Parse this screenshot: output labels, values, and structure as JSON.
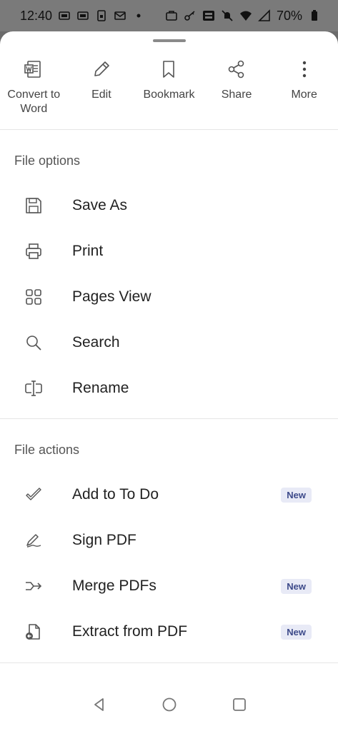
{
  "status_bar": {
    "time": "12:40",
    "battery": "70%"
  },
  "actions": [
    {
      "label": "Convert to Word",
      "icon": "word-icon"
    },
    {
      "label": "Edit",
      "icon": "pencil-icon"
    },
    {
      "label": "Bookmark",
      "icon": "bookmark-icon"
    },
    {
      "label": "Share",
      "icon": "share-icon"
    },
    {
      "label": "More",
      "icon": "more-vertical-icon"
    }
  ],
  "file_options": {
    "title": "File options",
    "items": [
      {
        "label": "Save As",
        "icon": "save-icon"
      },
      {
        "label": "Print",
        "icon": "printer-icon"
      },
      {
        "label": "Pages View",
        "icon": "grid-icon"
      },
      {
        "label": "Search",
        "icon": "search-icon"
      },
      {
        "label": "Rename",
        "icon": "rename-icon"
      }
    ]
  },
  "file_actions": {
    "title": "File actions",
    "items": [
      {
        "label": "Add to To Do",
        "icon": "todo-check-icon",
        "badge": "New"
      },
      {
        "label": "Sign PDF",
        "icon": "signature-icon",
        "badge": ""
      },
      {
        "label": "Merge PDFs",
        "icon": "merge-icon",
        "badge": "New"
      },
      {
        "label": "Extract from PDF",
        "icon": "extract-file-icon",
        "badge": "New"
      }
    ]
  }
}
